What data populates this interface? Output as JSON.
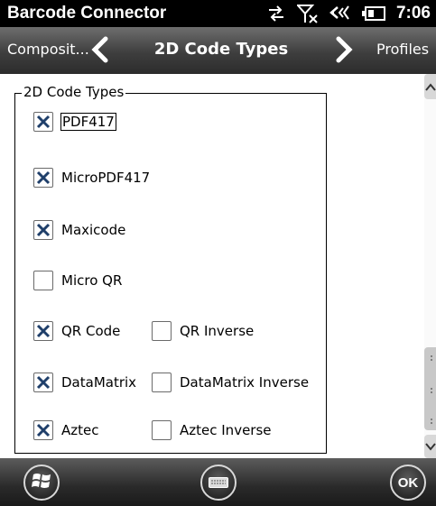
{
  "status_bar": {
    "app_title": "Barcode Connector",
    "time": "7:06",
    "icons": [
      "data-sync-icon",
      "no-signal-icon",
      "speaker-icon",
      "battery-icon"
    ]
  },
  "nav": {
    "prev_label": "Composit...",
    "title": "2D Code Types",
    "next_label": "Profiles"
  },
  "group": {
    "legend": "2D Code Types",
    "options": [
      {
        "label": "PDF417",
        "checked": true,
        "focused": true
      },
      {
        "label": "MicroPDF417",
        "checked": true
      },
      {
        "label": "Maxicode",
        "checked": true
      },
      {
        "label": "Micro QR",
        "checked": false
      },
      {
        "label": "QR Code",
        "checked": true
      },
      {
        "label": "QR Inverse",
        "checked": false
      },
      {
        "label": "DataMatrix",
        "checked": true
      },
      {
        "label": "DataMatrix Inverse",
        "checked": false
      },
      {
        "label": "Aztec",
        "checked": true
      },
      {
        "label": "Aztec Inverse",
        "checked": false
      }
    ]
  },
  "bottom_bar": {
    "ok_label": "OK"
  },
  "colors": {
    "check_mark": "#1f3f6a",
    "status_bg": "#000000"
  }
}
